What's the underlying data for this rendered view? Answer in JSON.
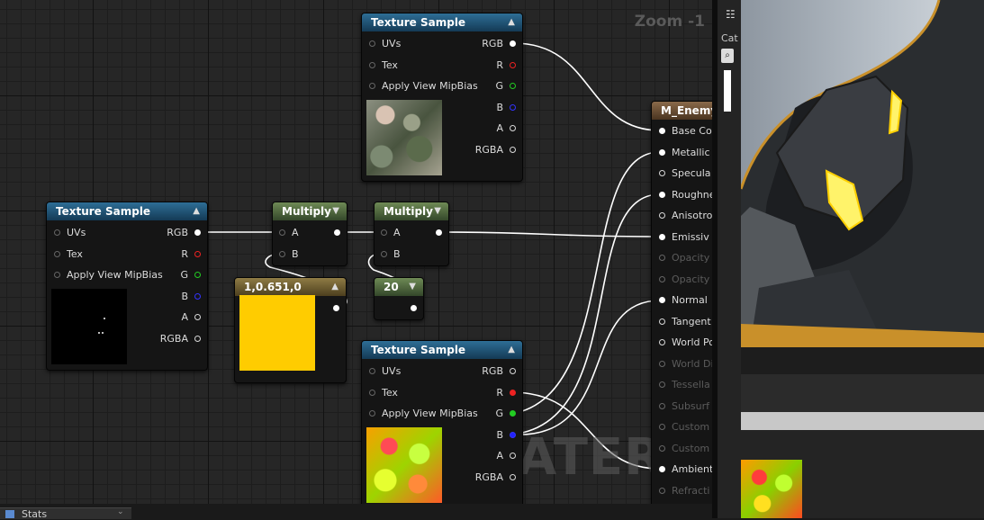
{
  "graph": {
    "zoom_label": "Zoom -1",
    "watermark": "MATERIAL"
  },
  "nodes": {
    "tex_top": {
      "title": "Texture Sample",
      "inputs": [
        "UVs",
        "Tex",
        "Apply View MipBias"
      ],
      "outputs": [
        "RGB",
        "R",
        "G",
        "B",
        "A",
        "RGBA"
      ]
    },
    "tex_left": {
      "title": "Texture Sample",
      "inputs": [
        "UVs",
        "Tex",
        "Apply View MipBias"
      ],
      "outputs": [
        "RGB",
        "R",
        "G",
        "B",
        "A",
        "RGBA"
      ]
    },
    "tex_bottom": {
      "title": "Texture Sample",
      "inputs": [
        "UVs",
        "Tex",
        "Apply View MipBias"
      ],
      "outputs": [
        "RGB",
        "R",
        "G",
        "B",
        "A",
        "RGBA"
      ]
    },
    "multiply1": {
      "title": "Multiply",
      "inputs": [
        "A",
        "B"
      ]
    },
    "multiply2": {
      "title": "Multiply",
      "inputs": [
        "A",
        "B"
      ]
    },
    "const_color": {
      "title": "1,0.651,0",
      "color": "#ffcc00"
    },
    "const_scalar": {
      "title": "20"
    },
    "material": {
      "title": "M_Enemy_",
      "inputs": [
        {
          "label": "Base Co",
          "active": true
        },
        {
          "label": "Metallic",
          "active": true
        },
        {
          "label": "Specula",
          "active": true
        },
        {
          "label": "Roughne",
          "active": true
        },
        {
          "label": "Anisotro",
          "active": true
        },
        {
          "label": "Emissiv",
          "active": true
        },
        {
          "label": "Opacity",
          "active": false
        },
        {
          "label": "Opacity",
          "active": false
        },
        {
          "label": "Normal",
          "active": true
        },
        {
          "label": "Tangent",
          "active": true
        },
        {
          "label": "World Po",
          "active": true
        },
        {
          "label": "World Di",
          "active": false
        },
        {
          "label": "Tessella",
          "active": false
        },
        {
          "label": "Subsurf",
          "active": false
        },
        {
          "label": "Custom",
          "active": false
        },
        {
          "label": "Custom",
          "active": false
        },
        {
          "label": "Ambient",
          "active": true
        },
        {
          "label": "Refracti",
          "active": false
        }
      ]
    }
  },
  "side_panel": {
    "category_label": "Cat"
  },
  "bottom_tab": {
    "label": "Stats"
  },
  "colors": {
    "accent_yellow": "#ffcc00",
    "texture_header": "#2e6e96",
    "multiply_header": "#6e8a55"
  }
}
